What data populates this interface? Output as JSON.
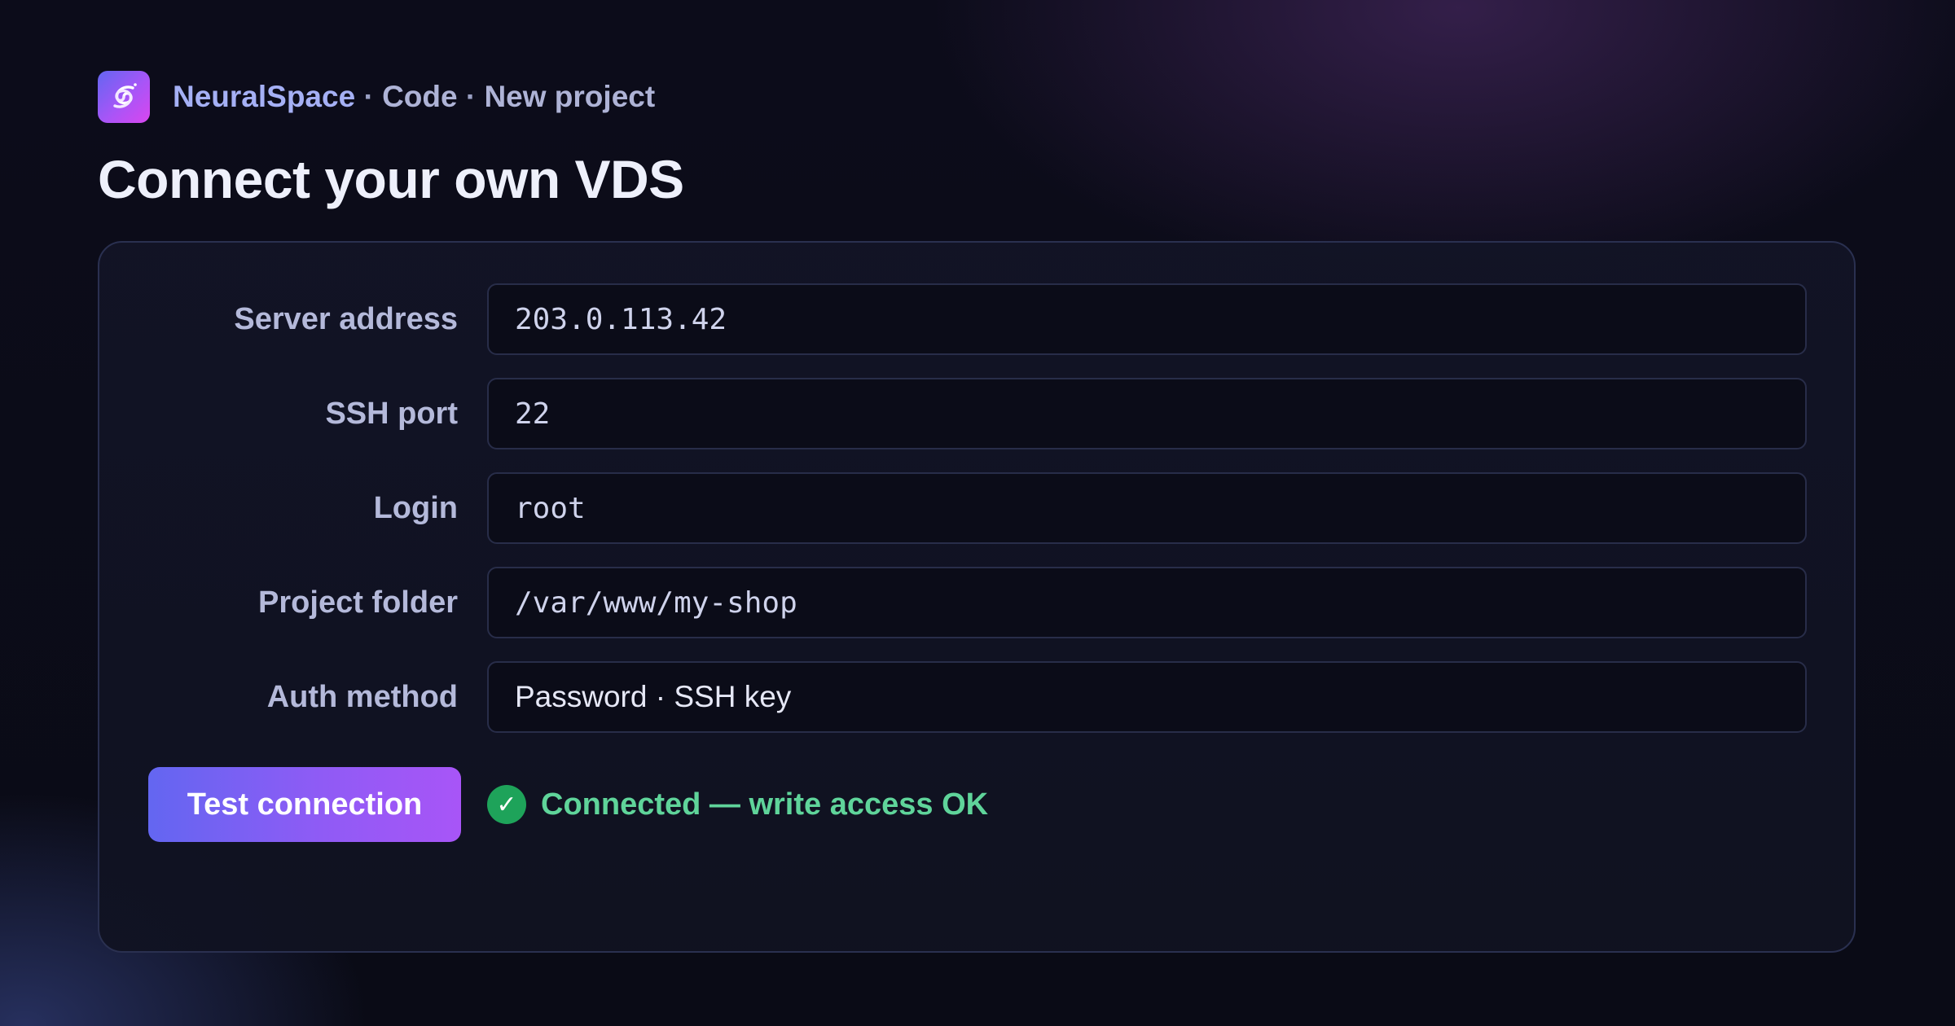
{
  "header": {
    "logo_icon": "spiral-galaxy-icon",
    "breadcrumb": {
      "brand": "NeuralSpace",
      "separator": " · ",
      "section": "Code",
      "page": "New project"
    }
  },
  "page_title": "Connect your own VDS",
  "form": {
    "fields": [
      {
        "label": "Server address",
        "value": "203.0.113.42"
      },
      {
        "label": "SSH port",
        "value": "22"
      },
      {
        "label": "Login",
        "value": "root"
      },
      {
        "label": "Project folder",
        "value": "/var/www/my-shop"
      },
      {
        "label": "Auth method",
        "value": "Password · SSH key"
      }
    ]
  },
  "actions": {
    "test_button_label": "Test connection"
  },
  "status": {
    "icon": "check-circle-icon",
    "glyph": "✓",
    "text": "Connected — write access OK",
    "color": "#5fd49a"
  },
  "colors": {
    "accent_start": "#6366f1",
    "accent_end": "#a855f7",
    "success": "#1ea35a"
  }
}
